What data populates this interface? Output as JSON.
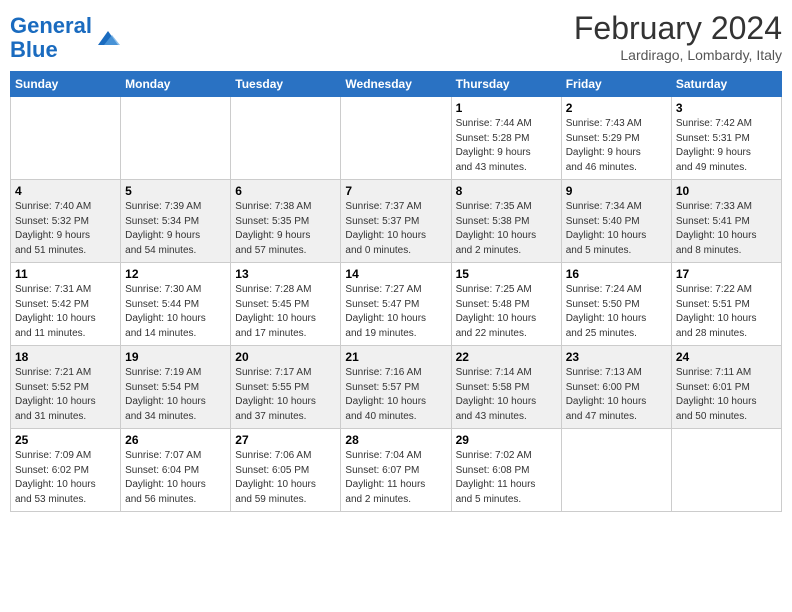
{
  "header": {
    "logo_text_general": "General",
    "logo_text_blue": "Blue",
    "month_title": "February 2024",
    "location": "Lardirago, Lombardy, Italy"
  },
  "days_of_week": [
    "Sunday",
    "Monday",
    "Tuesday",
    "Wednesday",
    "Thursday",
    "Friday",
    "Saturday"
  ],
  "weeks": [
    {
      "days": [
        {
          "num": "",
          "info": ""
        },
        {
          "num": "",
          "info": ""
        },
        {
          "num": "",
          "info": ""
        },
        {
          "num": "",
          "info": ""
        },
        {
          "num": "1",
          "info": "Sunrise: 7:44 AM\nSunset: 5:28 PM\nDaylight: 9 hours\nand 43 minutes."
        },
        {
          "num": "2",
          "info": "Sunrise: 7:43 AM\nSunset: 5:29 PM\nDaylight: 9 hours\nand 46 minutes."
        },
        {
          "num": "3",
          "info": "Sunrise: 7:42 AM\nSunset: 5:31 PM\nDaylight: 9 hours\nand 49 minutes."
        }
      ]
    },
    {
      "days": [
        {
          "num": "4",
          "info": "Sunrise: 7:40 AM\nSunset: 5:32 PM\nDaylight: 9 hours\nand 51 minutes."
        },
        {
          "num": "5",
          "info": "Sunrise: 7:39 AM\nSunset: 5:34 PM\nDaylight: 9 hours\nand 54 minutes."
        },
        {
          "num": "6",
          "info": "Sunrise: 7:38 AM\nSunset: 5:35 PM\nDaylight: 9 hours\nand 57 minutes."
        },
        {
          "num": "7",
          "info": "Sunrise: 7:37 AM\nSunset: 5:37 PM\nDaylight: 10 hours\nand 0 minutes."
        },
        {
          "num": "8",
          "info": "Sunrise: 7:35 AM\nSunset: 5:38 PM\nDaylight: 10 hours\nand 2 minutes."
        },
        {
          "num": "9",
          "info": "Sunrise: 7:34 AM\nSunset: 5:40 PM\nDaylight: 10 hours\nand 5 minutes."
        },
        {
          "num": "10",
          "info": "Sunrise: 7:33 AM\nSunset: 5:41 PM\nDaylight: 10 hours\nand 8 minutes."
        }
      ]
    },
    {
      "days": [
        {
          "num": "11",
          "info": "Sunrise: 7:31 AM\nSunset: 5:42 PM\nDaylight: 10 hours\nand 11 minutes."
        },
        {
          "num": "12",
          "info": "Sunrise: 7:30 AM\nSunset: 5:44 PM\nDaylight: 10 hours\nand 14 minutes."
        },
        {
          "num": "13",
          "info": "Sunrise: 7:28 AM\nSunset: 5:45 PM\nDaylight: 10 hours\nand 17 minutes."
        },
        {
          "num": "14",
          "info": "Sunrise: 7:27 AM\nSunset: 5:47 PM\nDaylight: 10 hours\nand 19 minutes."
        },
        {
          "num": "15",
          "info": "Sunrise: 7:25 AM\nSunset: 5:48 PM\nDaylight: 10 hours\nand 22 minutes."
        },
        {
          "num": "16",
          "info": "Sunrise: 7:24 AM\nSunset: 5:50 PM\nDaylight: 10 hours\nand 25 minutes."
        },
        {
          "num": "17",
          "info": "Sunrise: 7:22 AM\nSunset: 5:51 PM\nDaylight: 10 hours\nand 28 minutes."
        }
      ]
    },
    {
      "days": [
        {
          "num": "18",
          "info": "Sunrise: 7:21 AM\nSunset: 5:52 PM\nDaylight: 10 hours\nand 31 minutes."
        },
        {
          "num": "19",
          "info": "Sunrise: 7:19 AM\nSunset: 5:54 PM\nDaylight: 10 hours\nand 34 minutes."
        },
        {
          "num": "20",
          "info": "Sunrise: 7:17 AM\nSunset: 5:55 PM\nDaylight: 10 hours\nand 37 minutes."
        },
        {
          "num": "21",
          "info": "Sunrise: 7:16 AM\nSunset: 5:57 PM\nDaylight: 10 hours\nand 40 minutes."
        },
        {
          "num": "22",
          "info": "Sunrise: 7:14 AM\nSunset: 5:58 PM\nDaylight: 10 hours\nand 43 minutes."
        },
        {
          "num": "23",
          "info": "Sunrise: 7:13 AM\nSunset: 6:00 PM\nDaylight: 10 hours\nand 47 minutes."
        },
        {
          "num": "24",
          "info": "Sunrise: 7:11 AM\nSunset: 6:01 PM\nDaylight: 10 hours\nand 50 minutes."
        }
      ]
    },
    {
      "days": [
        {
          "num": "25",
          "info": "Sunrise: 7:09 AM\nSunset: 6:02 PM\nDaylight: 10 hours\nand 53 minutes."
        },
        {
          "num": "26",
          "info": "Sunrise: 7:07 AM\nSunset: 6:04 PM\nDaylight: 10 hours\nand 56 minutes."
        },
        {
          "num": "27",
          "info": "Sunrise: 7:06 AM\nSunset: 6:05 PM\nDaylight: 10 hours\nand 59 minutes."
        },
        {
          "num": "28",
          "info": "Sunrise: 7:04 AM\nSunset: 6:07 PM\nDaylight: 11 hours\nand 2 minutes."
        },
        {
          "num": "29",
          "info": "Sunrise: 7:02 AM\nSunset: 6:08 PM\nDaylight: 11 hours\nand 5 minutes."
        },
        {
          "num": "",
          "info": ""
        },
        {
          "num": "",
          "info": ""
        }
      ]
    }
  ]
}
